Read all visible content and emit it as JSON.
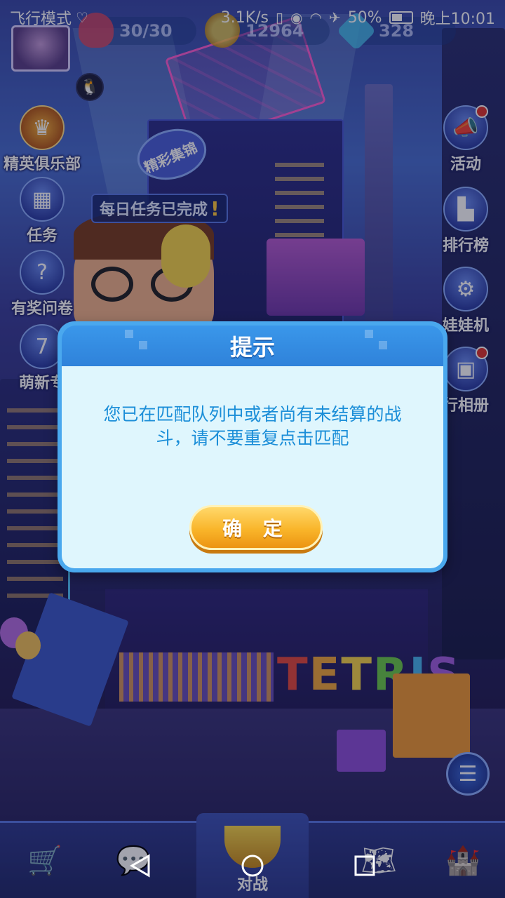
{
  "status_bar": {
    "airplane_mode": "飞行模式",
    "net_speed": "3.1K/s",
    "battery": "50%",
    "time": "晚上10:01"
  },
  "resources": {
    "hearts": "30/30",
    "coins": "12964",
    "gems": "328"
  },
  "side_left": [
    {
      "label": "精英俱乐部",
      "icon": "elite-badge-icon"
    },
    {
      "label": "任务",
      "icon": "calendar-icon"
    },
    {
      "label": "有奖问卷",
      "icon": "survey-icon"
    },
    {
      "label": "萌新专",
      "icon": "calendar-7-icon"
    }
  ],
  "side_right": [
    {
      "label": "活动",
      "icon": "megaphone-icon",
      "badge": true
    },
    {
      "label": "排行榜",
      "icon": "podium-icon",
      "badge": false
    },
    {
      "label": "娃娃机",
      "icon": "claw-machine-icon",
      "badge": false
    },
    {
      "label": "行相册",
      "icon": "album-icon",
      "badge": true
    }
  ],
  "task_banner": {
    "text": "每日任务已完成",
    "mark": "!"
  },
  "background_sign": "精彩集锦",
  "background_logo": [
    "T",
    "E",
    "T",
    "R",
    "I",
    "S"
  ],
  "dialog": {
    "title": "提示",
    "message": "您已在匹配队列中或者尚有未结算的战斗，请不要重复点击匹配",
    "confirm_label": "确 定"
  },
  "bottom_nav": {
    "center_label": "对战",
    "items": [
      "shop-cart-icon",
      "chat-icon",
      "battle-trophy-icon",
      "map-icon",
      "castle-icon"
    ]
  },
  "colors": {
    "dialog_border": "#4aa8ee",
    "dialog_body": "#dff6fd",
    "message_text": "#1b8ed8",
    "confirm_button": "#f9b52a"
  }
}
